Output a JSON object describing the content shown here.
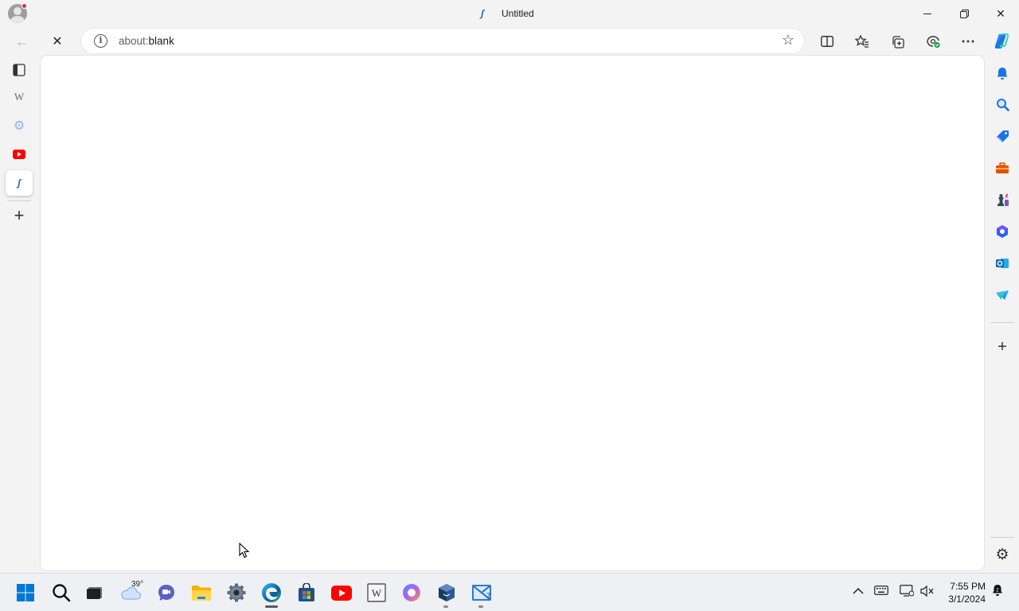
{
  "titlebar": {
    "tab_title": "Untitled",
    "favicon_glyph": "ʃ",
    "minimize_glyph": "—",
    "restore_glyph": "❐",
    "close_glyph": "✕"
  },
  "toolbar": {
    "back_glyph": "←",
    "stop_glyph": "✕",
    "url_scheme": "about:",
    "url_path": "blank",
    "info_glyph": "i",
    "favorite_glyph": "☆",
    "more_glyph": "⋯"
  },
  "vertical_tabs": [
    {
      "name": "tab-actions-icon",
      "glyph": "◫",
      "color": "#333333"
    },
    {
      "name": "wikipedia-tab-icon",
      "glyph": "W",
      "color": "#555555"
    },
    {
      "name": "settings-tab-icon",
      "glyph": "⚙",
      "color": "#8ab4f8"
    },
    {
      "name": "youtube-tab-icon",
      "glyph": "▶",
      "color": "#ff0000"
    },
    {
      "name": "untitled-tab-icon",
      "glyph": "ʃ",
      "color": "#2962a8"
    }
  ],
  "new_tab_glyph": "+",
  "sidebar": {
    "items": [
      {
        "name": "copilot-icon",
        "color": "#1e88e5"
      },
      {
        "name": "notifications-icon",
        "glyph": "🔔",
        "color": "#1a73e8"
      },
      {
        "name": "search-icon",
        "glyph": "🔍",
        "color": "#1a73e8"
      },
      {
        "name": "shopping-icon",
        "glyph": "◆",
        "color": "#1a73e8"
      },
      {
        "name": "tools-icon",
        "glyph": "■",
        "color": "#d84315"
      },
      {
        "name": "games-icon",
        "glyph": "♟",
        "color": "#5e35b1"
      },
      {
        "name": "microsoft365-icon",
        "glyph": "⬢",
        "color": "#2962ff"
      },
      {
        "name": "outlook-icon",
        "glyph": "O",
        "color": "#0f6cbd"
      },
      {
        "name": "drop-icon",
        "glyph": "➤",
        "color": "#0ea5e9"
      }
    ],
    "add_glyph": "+",
    "settings_glyph": "⚙"
  },
  "taskbar": {
    "weather_temp": "39°",
    "time": "7:55 PM",
    "date": "3/1/2024",
    "apps": [
      {
        "name": "start-icon",
        "color": "#0078d4"
      },
      {
        "name": "taskbar-search-icon",
        "color": "#222222"
      },
      {
        "name": "task-view-icon",
        "color": "#333333"
      },
      {
        "name": "weather-icon",
        "color": "#8ab4e8"
      },
      {
        "name": "teams-icon",
        "color": "#5b5fc7"
      },
      {
        "name": "file-explorer-icon",
        "color": "#f4c430"
      },
      {
        "name": "settings-app-icon",
        "color": "#5f6b7a"
      },
      {
        "name": "edge-icon",
        "color": "#0c8ce9"
      },
      {
        "name": "store-icon",
        "color": "#0067c0"
      },
      {
        "name": "youtube-app-icon",
        "color": "#ff0000"
      },
      {
        "name": "wikipedia-app-icon",
        "color": "#555555"
      },
      {
        "name": "copilot-app-icon",
        "color": "#8e6cf0"
      },
      {
        "name": "virtualbox-icon",
        "color": "#183a61"
      },
      {
        "name": "app7-icon",
        "color": "#1f6fb2"
      }
    ]
  }
}
